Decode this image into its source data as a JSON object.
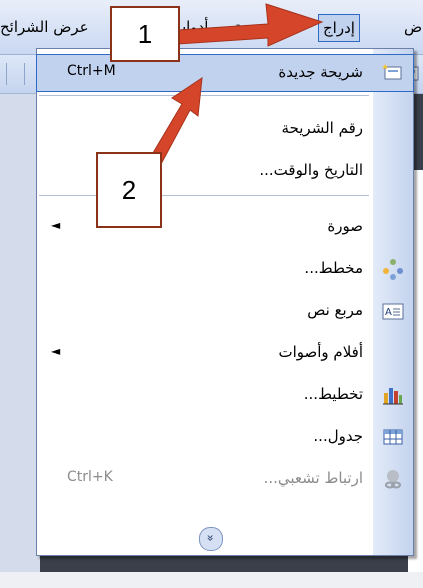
{
  "menubar": {
    "items": [
      {
        "label": "ض"
      },
      {
        "label": "إدراج"
      },
      {
        "label": "نسيق"
      },
      {
        "label": "أدوات"
      },
      {
        "label": "عرض الشرائح"
      }
    ]
  },
  "menu": {
    "items": [
      {
        "label": "شريحة جديدة",
        "shortcut": "Ctrl+M",
        "icon": "new-slide-icon"
      },
      {
        "label": "رقم الشريحة"
      },
      {
        "label": "التاريخ والوقت..."
      },
      {
        "label": "صورة",
        "submenu_arrow": "◄"
      },
      {
        "label": "مخطط...",
        "icon": "diagram-icon"
      },
      {
        "label": "مربع نص",
        "icon": "text-box-icon"
      },
      {
        "label": "أفلام وأصوات",
        "submenu_arrow": "◄"
      },
      {
        "label": "تخطيط...",
        "icon": "chart-icon"
      },
      {
        "label": "جدول...",
        "icon": "table-icon"
      },
      {
        "label": "ارتباط تشعبي...",
        "shortcut": "Ctrl+K",
        "icon": "hyperlink-icon",
        "disabled": true
      }
    ],
    "expand_glyph": "»"
  },
  "callouts": {
    "one": "1",
    "two": "2"
  },
  "colors": {
    "arrow": "#d4452a",
    "menu_highlight": "#c1d2ee",
    "menu_border": "#316ac5"
  }
}
